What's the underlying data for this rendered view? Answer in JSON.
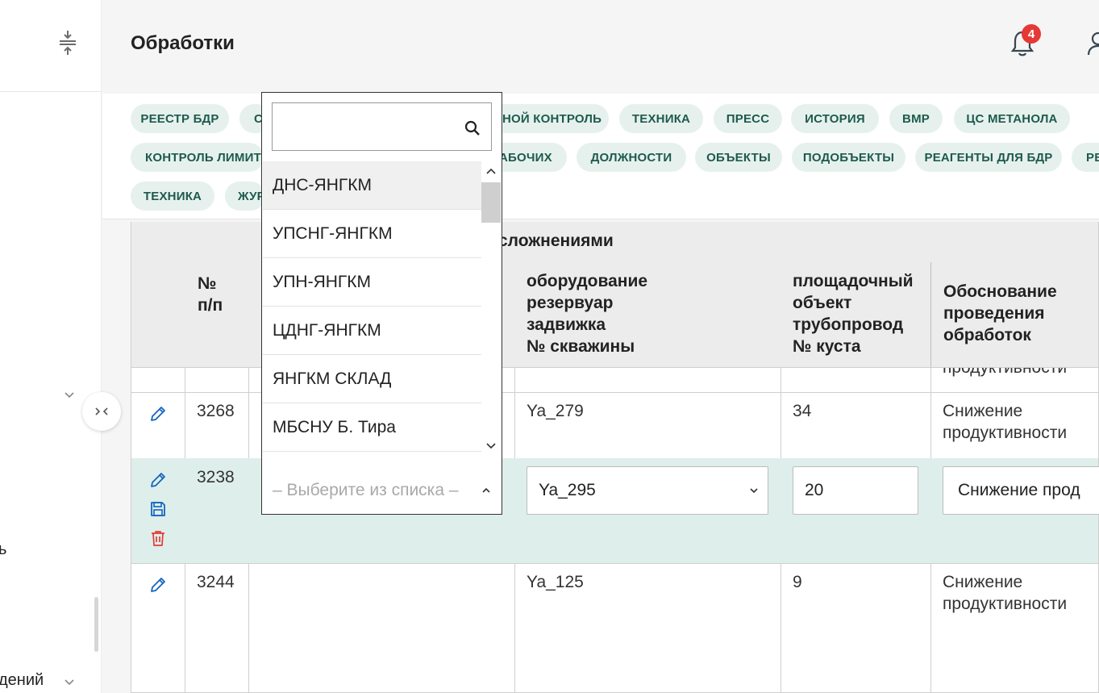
{
  "page": {
    "title": "Обработки"
  },
  "header": {
    "notifications_count": "4"
  },
  "sidebar": {
    "labels": [
      {
        "key": "item_partial_1",
        "text": "ь"
      },
      {
        "key": "item_partial_2",
        "text": "дений"
      }
    ]
  },
  "chips": {
    "row1": [
      "РЕЕСТР БДР",
      "С",
      "НОЙ КОНТРОЛЬ",
      "ТЕХНИКА",
      "ПРЕСС",
      "ИСТОРИЯ",
      "ВМР",
      "ЦС МЕТАНОЛА"
    ],
    "row2": [
      "КОНТРОЛЬ ЛИМИТ",
      "АБОЧИХ",
      "ДОЛЖНОСТИ",
      "ОБЪЕКТЫ",
      "ПОДОБЪЕКТЫ",
      "РЕАГЕНТЫ ДЛЯ БДР",
      "РЕ"
    ],
    "row3": [
      "ТЕХНИКА",
      "ЖУР"
    ]
  },
  "table": {
    "group_header": "сложнениями",
    "headers": {
      "num": "№\nп/п",
      "equipment": "оборудование\nрезервуар\nзадвижка\n№ скважины",
      "site": "площадочный\nобъект\nтрубопровод\n№ куста",
      "reason": "Обоснование\nпроведения\nобработок"
    },
    "partial_top_text": "продуктивности",
    "rows": [
      {
        "num": "3268",
        "equipment": "Ya_279",
        "site": "34",
        "reason": "Снижение\nпродуктивности"
      },
      {
        "num": "3238",
        "equipment": "Ya_295",
        "site": "20",
        "reason": "Снижение прод",
        "editing": true
      },
      {
        "num": "3244",
        "equipment": "Ya_125",
        "site": "9",
        "reason": "Снижение\nпродуктивности"
      }
    ]
  },
  "dropdown": {
    "search_value": "",
    "options": [
      "ДНС-ЯНГКМ",
      "УПСНГ-ЯНГКМ",
      "УПН-ЯНГКМ",
      "ЦДНГ-ЯНГКМ",
      "ЯНГКМ СКЛАД",
      "МБСНУ Б. Тира"
    ],
    "placeholder": "– Выберите из списка –"
  },
  "colors": {
    "chip_bg": "#e6f1ee",
    "chip_text": "#1e5a4c",
    "highlight_row": "#deeeeb",
    "badge": "#e53935",
    "edit_icon": "#1565c0",
    "delete_icon": "#e53935"
  }
}
